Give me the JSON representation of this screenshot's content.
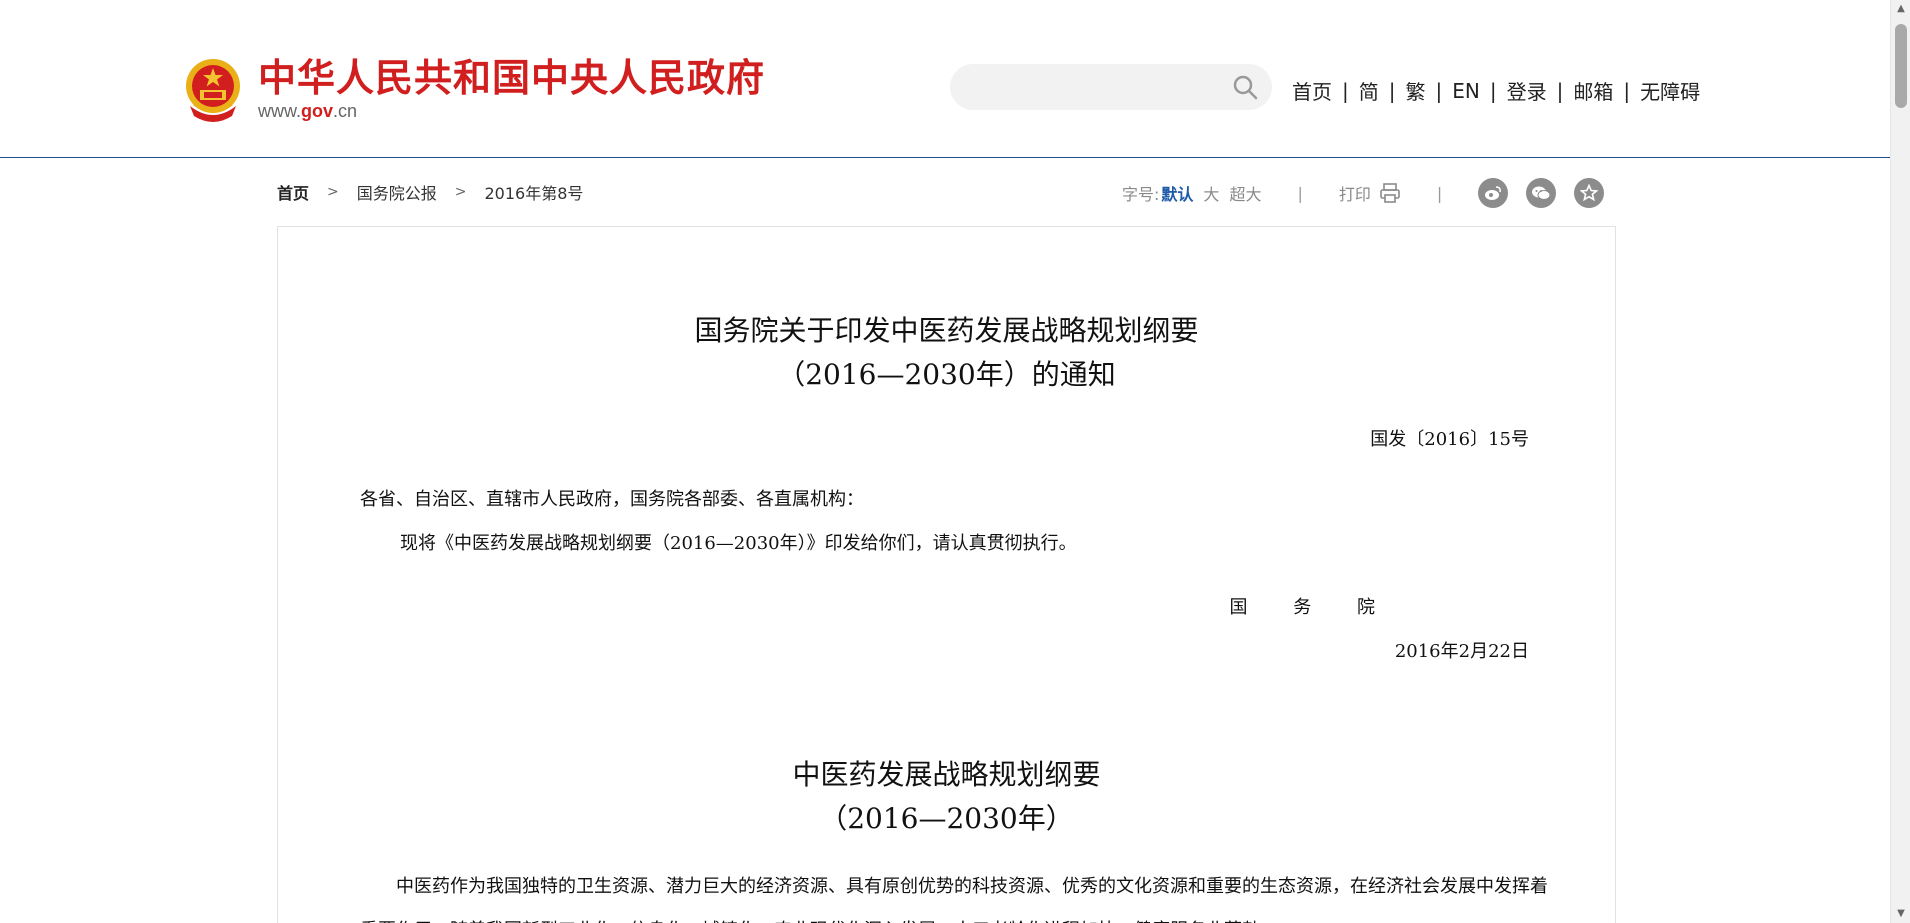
{
  "header": {
    "site_title": "中华人民共和国中央人民政府",
    "domain_prefix": "www.",
    "domain_gov": "gov",
    "domain_suffix": ".cn",
    "search": {
      "placeholder": ""
    },
    "nav": [
      "首页",
      "简",
      "繁",
      "EN",
      "登录",
      "邮箱",
      "无障碍"
    ]
  },
  "breadcrumb": [
    "首页",
    "国务院公报",
    "2016年第8号"
  ],
  "tools": {
    "font_label": "字号:",
    "font_default": "默认",
    "font_large": "大",
    "font_xlarge": "超大",
    "print_label": "打印"
  },
  "document": {
    "title_line1": "国务院关于印发中医药发展战略规划纲要",
    "title_line2": "（2016—2030年）的通知",
    "doc_number": "国发〔2016〕15号",
    "addressee": "各省、自治区、直辖市人民政府，国务院各部委、各直属机构：",
    "body": "现将《中医药发展战略规划纲要（2016—2030年）》印发给你们，请认真贯彻执行。",
    "signatory": "国 务 院",
    "date": "2016年2月22日",
    "subtitle_line1": "中医药发展战略规划纲要",
    "subtitle_line2": "（2016—2030年）",
    "body2": "中医药作为我国独特的卫生资源、潜力巨大的经济资源、具有原创优势的科技资源、优秀的文化资源和重要的生态资源，在经济社会发展中发挥着重要作用。随着我国新型工业化、信息化、城镇化、农业现代化深入发展，人口老龄化进程加快，健康服务业蓬勃"
  },
  "colors": {
    "brand_red": "#d11f1f",
    "link_blue": "#1f5ba9",
    "header_rule": "#1f4f8f",
    "share_grey": "#8c8c8c"
  }
}
